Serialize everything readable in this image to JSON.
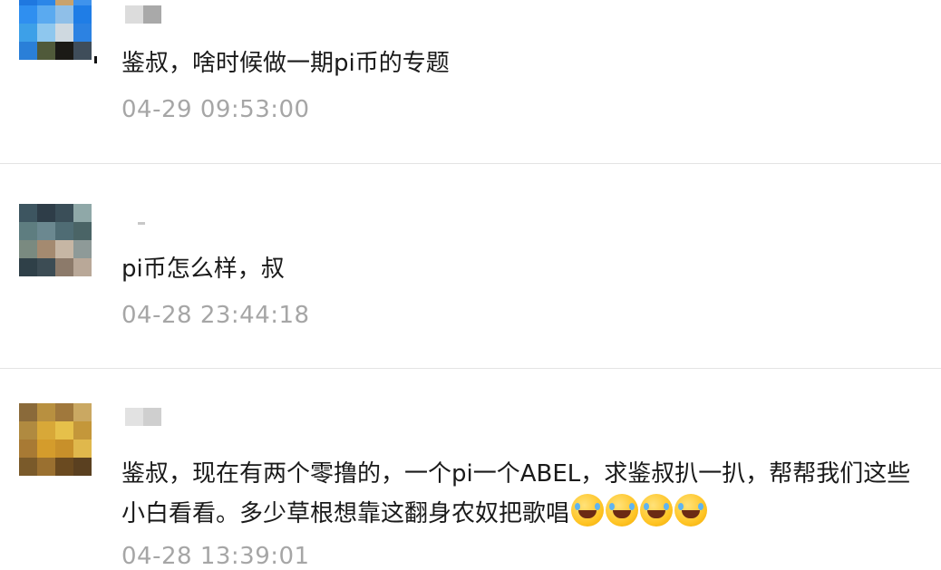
{
  "comments": [
    {
      "text": "鉴叔，啥时候做一期pi币的专题",
      "time": "04-29 09:53:00",
      "emojis": []
    },
    {
      "text": "pi币怎么样，叔",
      "time": "04-28 23:44:18",
      "emojis": []
    },
    {
      "text": "鉴叔，现在有两个零撸的，一个pi一个ABEL，求鉴叔扒一扒，帮帮我们这些小白看看。多少草根想靠这翻身农奴把歌唱",
      "time": "04-28 13:39:01",
      "emojis": [
        "face-with-tears-of-joy-rolling",
        "face-with-tears-of-joy-rolling",
        "face-with-tears-of-joy",
        "face-with-tears-of-joy"
      ]
    }
  ],
  "colors": {
    "text": "#1a1a1a",
    "timestamp": "#a6a6a6",
    "divider": "#e3e3e3",
    "background": "#ffffff"
  }
}
